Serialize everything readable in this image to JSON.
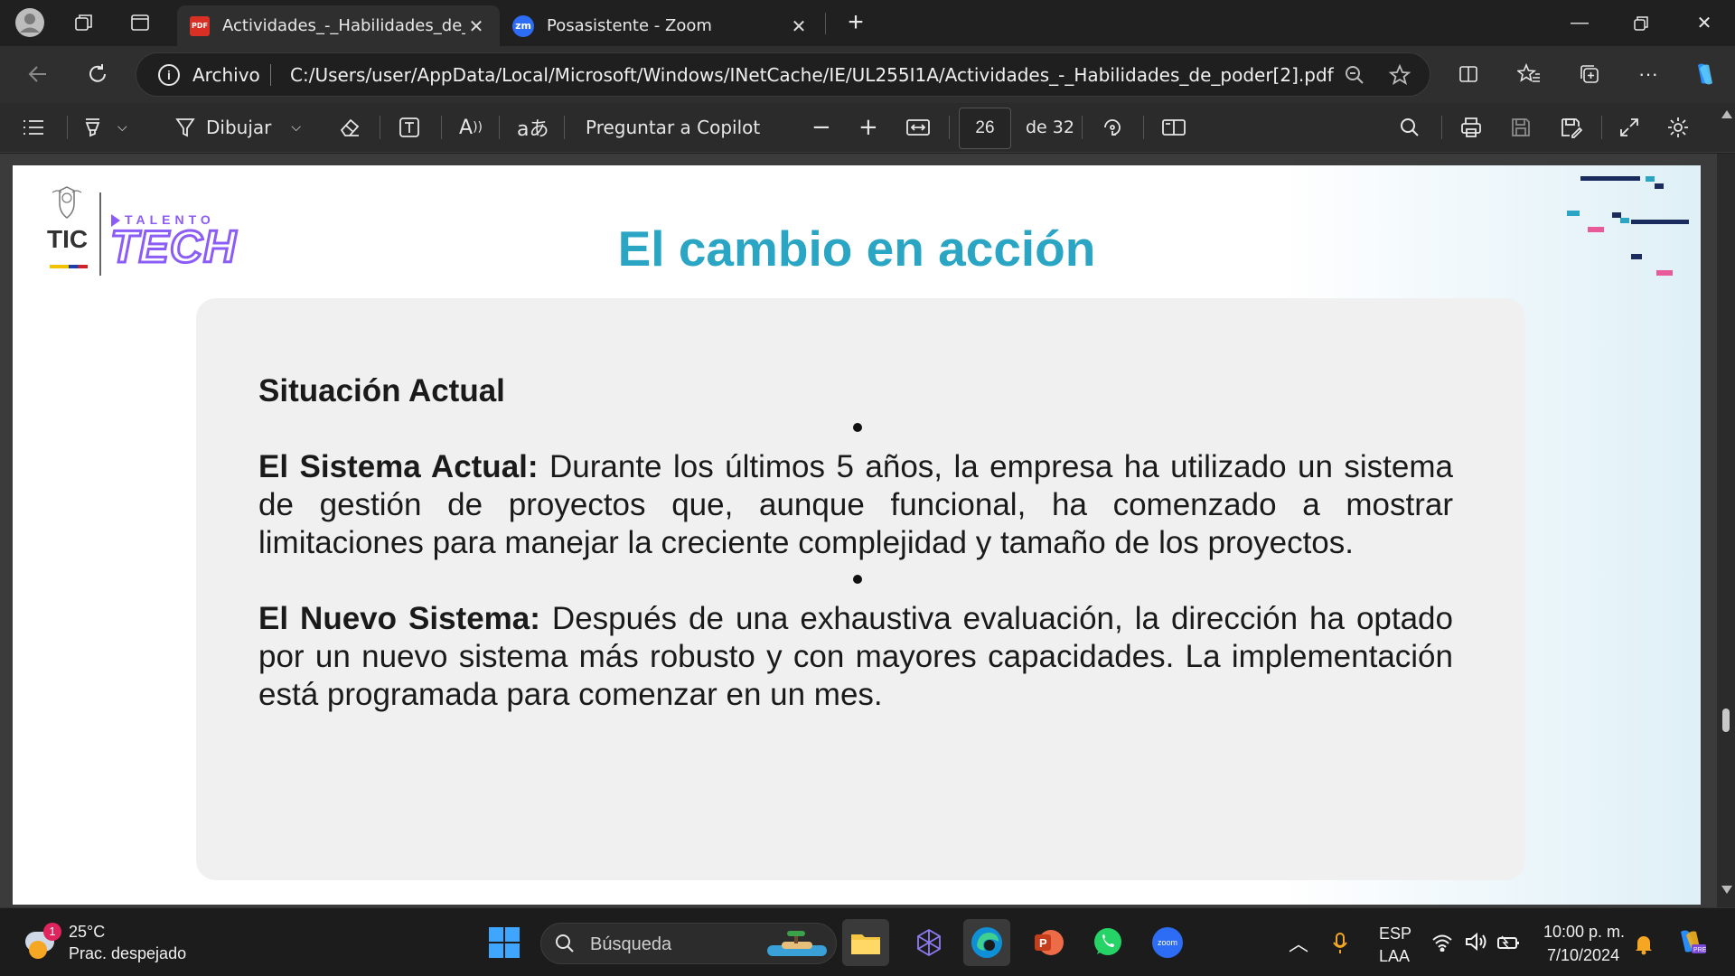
{
  "browser": {
    "tabs": [
      {
        "title": "Actividades_-_Habilidades_de_poder[2].pdf",
        "icon": "pdf-icon",
        "active": true
      },
      {
        "title": "Posasistente - Zoom",
        "icon": "zoom-icon",
        "active": false
      }
    ],
    "new_tab_symbol": "+",
    "address": {
      "scheme_label": "Archivo",
      "url": "C:/Users/user/AppData/Local/Microsoft/Windows/INetCache/IE/UL255I1A/Actividades_-_Habilidades_de_poder[2].pdf"
    }
  },
  "pdf_toolbar": {
    "draw_label": "Dibujar",
    "copilot_label": "Preguntar a Copilot",
    "page_current": "26",
    "page_total_label": "de 32"
  },
  "slide": {
    "logo_tic": "TIC",
    "logo_talento": "TALENTO",
    "logo_tech": "TECH",
    "title": "El cambio en acción",
    "heading": "Situación Actual",
    "item1_bold": "El Sistema Actual:",
    "item1_text": " Durante los últimos 5 años, la empresa ha utilizado un sistema de gestión de proyectos que, aunque funcional, ha comenzado a mostrar limitaciones para manejar la creciente complejidad y tamaño de los proyectos.",
    "item2_bold": "El Nuevo Sistema:",
    "item2_text": " Después de una exhaustiva evaluación, la dirección ha optado por un nuevo sistema más robusto y con mayores capacidades. La implementación está programada para comenzar en un mes."
  },
  "taskbar": {
    "weather_temp": "25°C",
    "weather_desc": "Prac. despejado",
    "weather_badge": "1",
    "search_placeholder": "Búsqueda",
    "lang_top": "ESP",
    "lang_bottom": "LAA",
    "time": "10:00 p. m.",
    "date": "7/10/2024"
  },
  "colors": {
    "title_teal": "#2aa6c4",
    "tech_purple": "#8b5cf6",
    "card_bg": "#f0f0f0"
  }
}
